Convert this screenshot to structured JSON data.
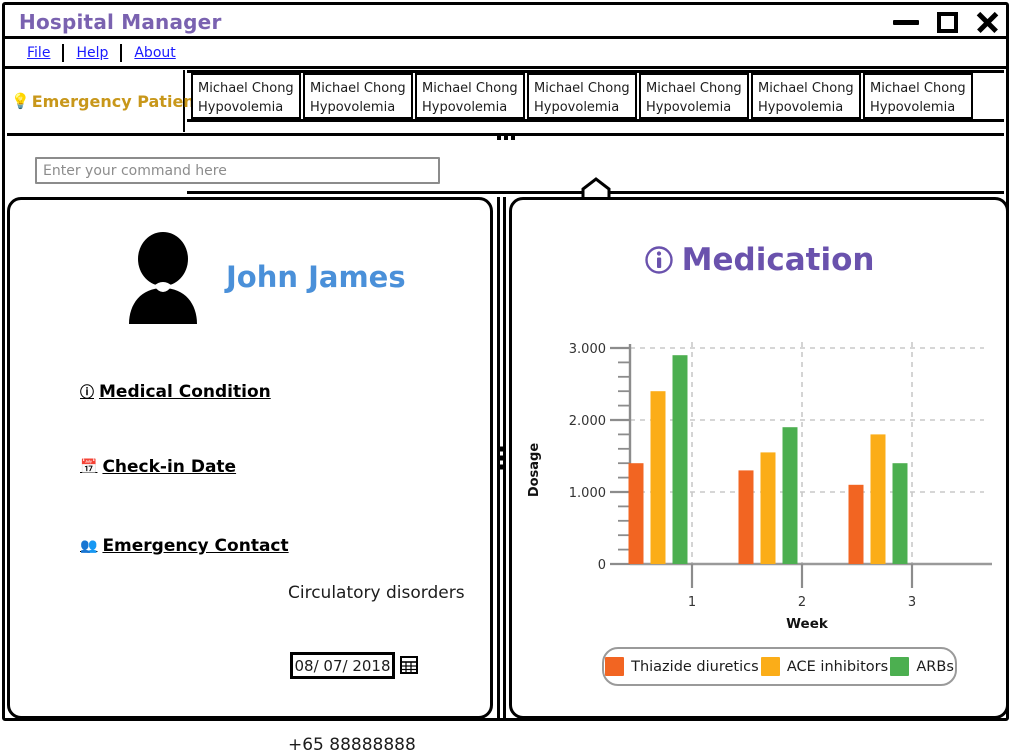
{
  "window": {
    "title": "Hospital Manager",
    "controls": {
      "minimize": "minimize",
      "maximize": "maximize",
      "close": "close"
    }
  },
  "menu": {
    "items": [
      {
        "label": "File"
      },
      {
        "label": "Help"
      },
      {
        "label": "About"
      }
    ]
  },
  "tabstrip": {
    "section_label": "Emergency Patients",
    "section_icon": "lightbulb-icon",
    "tabs": [
      {
        "name": "Michael Chong",
        "condition": "Hypovolemia"
      },
      {
        "name": "Michael Chong",
        "condition": "Hypovolemia"
      },
      {
        "name": "Michael Chong",
        "condition": "Hypovolemia"
      },
      {
        "name": "Michael Chong",
        "condition": "Hypovolemia"
      },
      {
        "name": "Michael Chong",
        "condition": "Hypovolemia"
      },
      {
        "name": "Michael Chong",
        "condition": "Hypovolemia"
      },
      {
        "name": "Michael Chong",
        "condition": "Hypovolemia"
      }
    ]
  },
  "command": {
    "value": "",
    "placeholder": "Enter your command here"
  },
  "patient": {
    "name": "John James",
    "avatar_icon": "user-avatar-icon",
    "details": [
      {
        "icon": "question-circle-icon",
        "label": "Medical Condition",
        "value": "Circulatory disorders"
      },
      {
        "icon": "calendar-day-icon",
        "label": "Check-in Date",
        "value": "08/ 07/ 2018"
      },
      {
        "icon": "users-icon",
        "label": "Emergency Contact",
        "value": "+65 88888888"
      }
    ]
  },
  "medication": {
    "title": "Medication",
    "icon": "info-circle-icon"
  },
  "colors": {
    "title_purple": "#7a62b0",
    "medication_purple": "#6a52ad",
    "patient_name_blue": "#4a90d9",
    "emergency_gold": "#c8971a",
    "menu_link_blue": "#1a1aff",
    "series_thiazide": "#f26522",
    "series_ace": "#fbad18",
    "series_arbs": "#4caf50"
  },
  "chart_data": {
    "type": "bar",
    "title": "",
    "xlabel": "Week",
    "ylabel": "Dosage",
    "categories": [
      "1",
      "2",
      "3"
    ],
    "ylim": [
      0,
      3000
    ],
    "yticks": [
      0,
      1000,
      2000,
      3000
    ],
    "ytick_labels": [
      "0",
      "1.000",
      "2.000",
      "3.000"
    ],
    "grid": true,
    "legend_position": "bottom",
    "series": [
      {
        "name": "Thiazide diuretics",
        "color": "#f26522",
        "values": [
          1400,
          1300,
          1100
        ]
      },
      {
        "name": "ACE inhibitors",
        "color": "#fbad18",
        "values": [
          2400,
          1550,
          1800
        ]
      },
      {
        "name": "ARBs",
        "color": "#4caf50",
        "values": [
          2900,
          1900,
          1400
        ]
      }
    ]
  }
}
